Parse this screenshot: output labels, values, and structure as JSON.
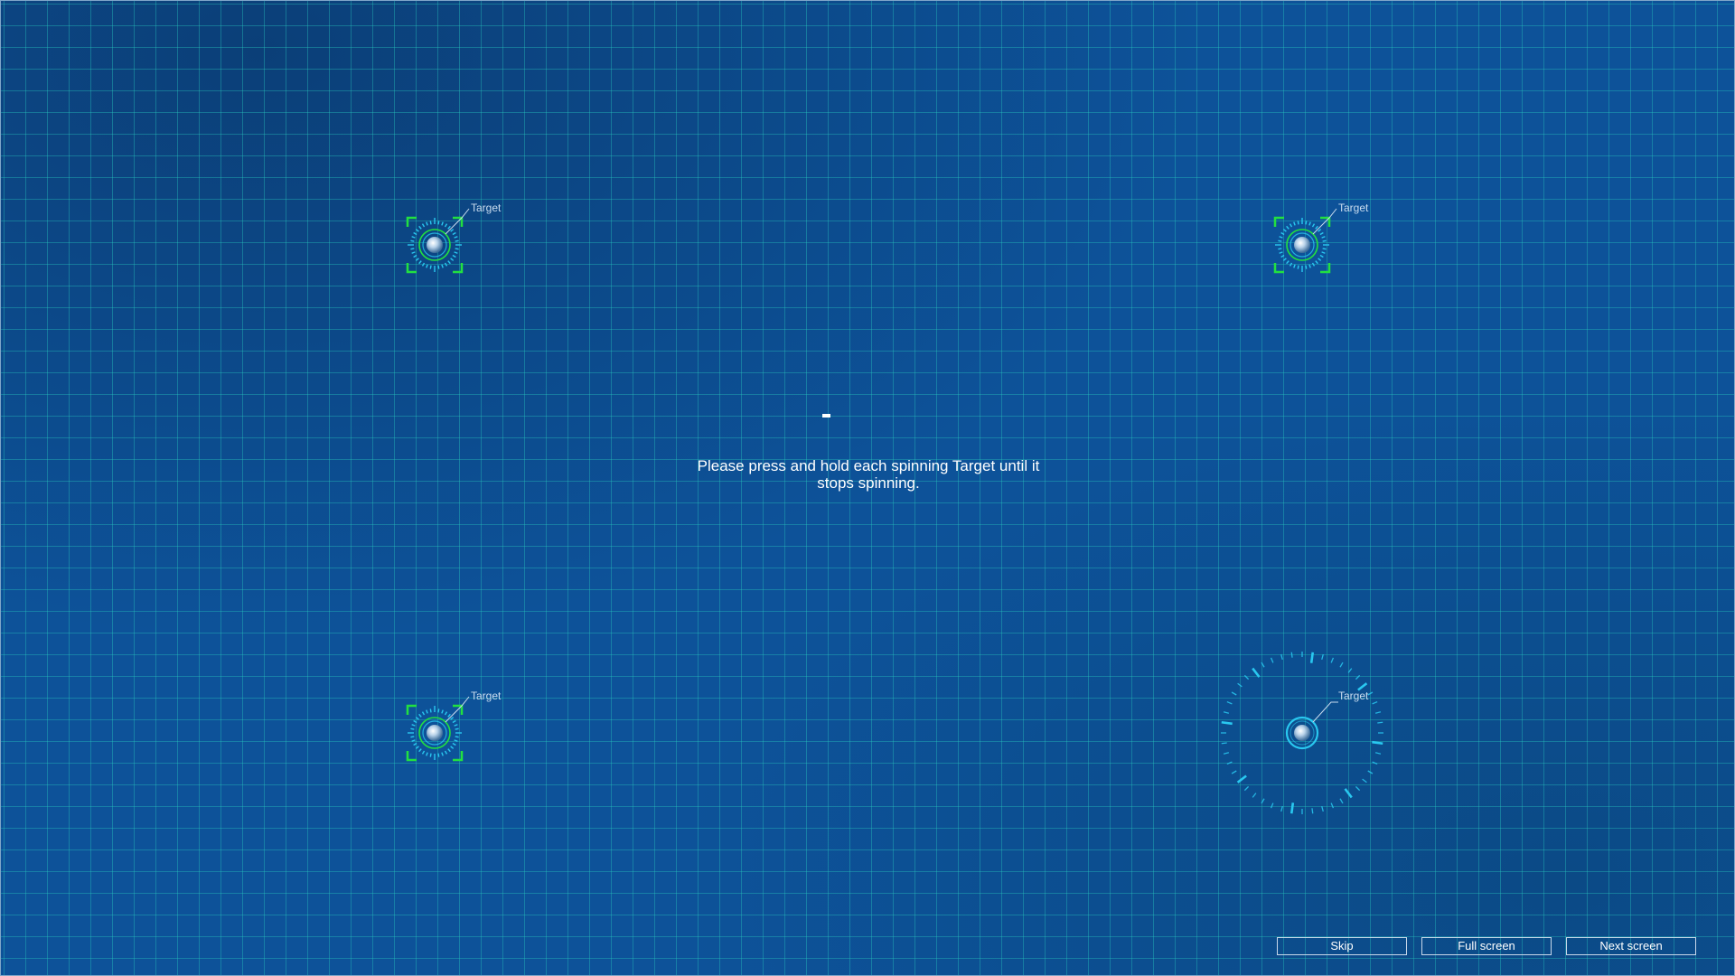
{
  "colors": {
    "background": "#0d5299",
    "grid": "#28c8be",
    "target_frame_green": "#22e040",
    "target_ring_cyan": "#29c8f0",
    "text": "#ffffff"
  },
  "targets": [
    {
      "label": "Target",
      "state": "calibrated",
      "icon": "crosshair-target-icon"
    },
    {
      "label": "Target",
      "state": "calibrated",
      "icon": "crosshair-target-icon"
    },
    {
      "label": "Target",
      "state": "calibrated",
      "icon": "crosshair-target-icon"
    },
    {
      "label": "Target",
      "state": "spinning",
      "icon": "spinning-target-icon"
    }
  ],
  "instructions": "Please press and hold each spinning Target until it stops spinning.",
  "buttons": {
    "skip": "Skip",
    "full_screen": "Full screen",
    "next_screen": "Next screen"
  }
}
